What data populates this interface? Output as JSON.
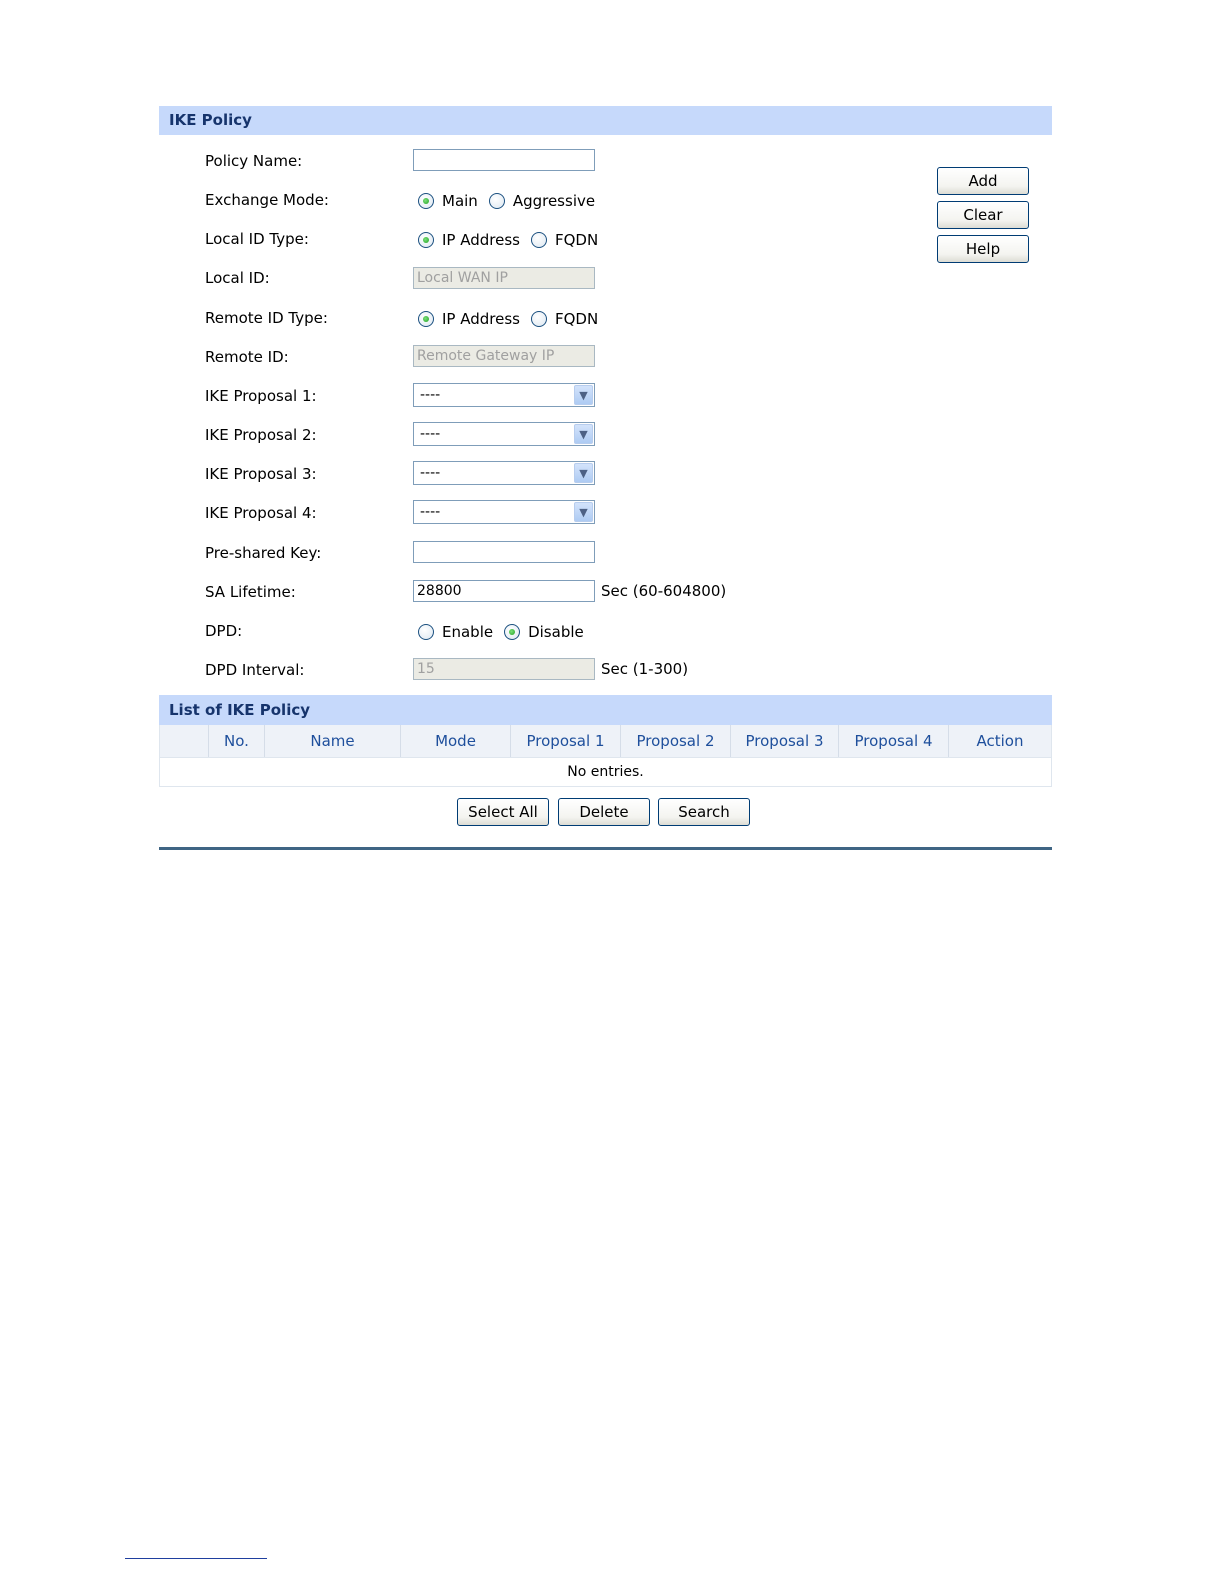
{
  "ike_policy": {
    "title": "IKE Policy",
    "policy_name": {
      "label": "Policy Name:",
      "value": ""
    },
    "exchange_mode": {
      "label": "Exchange Mode:",
      "options": [
        "Main",
        "Aggressive"
      ],
      "selected": "Main"
    },
    "local_id_type": {
      "label": "Local ID Type:",
      "options": [
        "IP Address",
        "FQDN"
      ],
      "selected": "IP Address"
    },
    "local_id": {
      "label": "Local ID:",
      "placeholder": "Local WAN IP"
    },
    "remote_id_type": {
      "label": "Remote ID Type:",
      "options": [
        "IP Address",
        "FQDN"
      ],
      "selected": "IP Address"
    },
    "remote_id": {
      "label": "Remote ID:",
      "placeholder": "Remote Gateway IP"
    },
    "proposals": [
      {
        "label": "IKE Proposal 1:",
        "value": "----"
      },
      {
        "label": "IKE Proposal 2:",
        "value": "----"
      },
      {
        "label": "IKE Proposal 3:",
        "value": "----"
      },
      {
        "label": "IKE Proposal 4:",
        "value": "----"
      }
    ],
    "pre_shared_key": {
      "label": "Pre-shared Key:",
      "value": ""
    },
    "sa_lifetime": {
      "label": "SA Lifetime:",
      "value": "28800",
      "hint": "Sec (60-604800)"
    },
    "dpd": {
      "label": "DPD:",
      "options": [
        "Enable",
        "Disable"
      ],
      "selected": "Disable"
    },
    "dpd_interval": {
      "label": "DPD Interval:",
      "value": "15",
      "hint": "Sec (1-300)"
    },
    "buttons": {
      "add": "Add",
      "clear": "Clear",
      "help": "Help"
    }
  },
  "list": {
    "title": "List of IKE Policy",
    "columns": [
      "No.",
      "Name",
      "Mode",
      "Proposal 1",
      "Proposal 2",
      "Proposal 3",
      "Proposal 4",
      "Action"
    ],
    "empty_text": "No entries.",
    "buttons": {
      "select_all": "Select All",
      "delete": "Delete",
      "search": "Search"
    }
  },
  "colors": {
    "header_bg": "#c6d9fb",
    "header_text": "#16346c",
    "column_text": "#1e4f9c",
    "rule": "#3f6584"
  },
  "icons": {
    "select_arrow": "chevron-down-icon"
  }
}
